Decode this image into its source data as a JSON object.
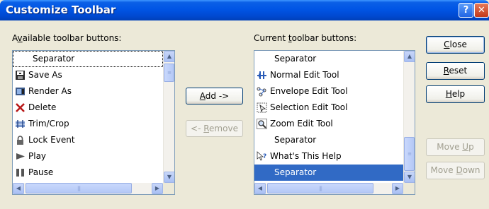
{
  "window": {
    "title": "Customize Toolbar",
    "help_button": "?",
    "close_button": "✕"
  },
  "available": {
    "label": "Available toolbar buttons:",
    "items": [
      {
        "label": "Separator",
        "icon": "none"
      },
      {
        "label": "Save As",
        "icon": "save-as-icon"
      },
      {
        "label": "Render As",
        "icon": "render-as-icon"
      },
      {
        "label": "Delete",
        "icon": "delete-icon"
      },
      {
        "label": "Trim/Crop",
        "icon": "trim-crop-icon"
      },
      {
        "label": "Lock Event",
        "icon": "lock-icon"
      },
      {
        "label": "Play",
        "icon": "play-icon"
      },
      {
        "label": "Pause",
        "icon": "pause-icon"
      }
    ]
  },
  "current": {
    "label": "Current toolbar buttons:",
    "items": [
      {
        "label": "Separator",
        "icon": "none"
      },
      {
        "label": "Normal Edit Tool",
        "icon": "normal-edit-tool-icon"
      },
      {
        "label": "Envelope Edit Tool",
        "icon": "envelope-edit-tool-icon"
      },
      {
        "label": "Selection Edit Tool",
        "icon": "selection-edit-tool-icon"
      },
      {
        "label": "Zoom Edit Tool",
        "icon": "zoom-icon"
      },
      {
        "label": "Separator",
        "icon": "none"
      },
      {
        "label": "What's This Help",
        "icon": "whats-this-help-icon"
      },
      {
        "label": "Separator",
        "icon": "none",
        "selected": true
      }
    ]
  },
  "buttons": {
    "add": "Add ->",
    "remove": "<- Remove",
    "close": "Close",
    "reset": "Reset",
    "help": "Help",
    "move_up": "Move Up",
    "move_down": "Move Down"
  },
  "colors": {
    "titlebar": "#0055E5",
    "selection": "#316AC5",
    "dialog_bg": "#ECE9D8"
  }
}
